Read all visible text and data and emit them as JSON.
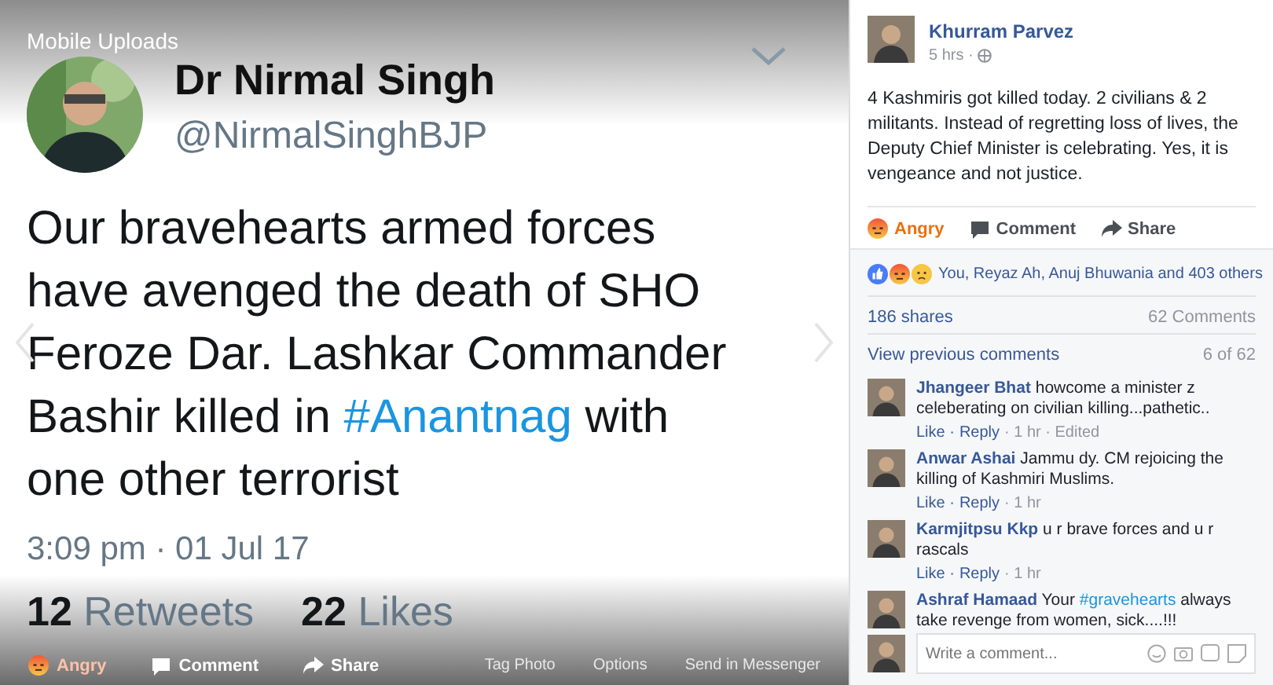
{
  "viewer": {
    "album": "Mobile Uploads",
    "tweet": {
      "name": "Dr Nirmal Singh",
      "handle": "@NirmalSinghBJP",
      "body": [
        {
          "kind": "plain",
          "text": "Our bravehearts armed forces have avenged the death of SHO Feroze Dar. Lashkar Commander Bashir killed in "
        },
        {
          "kind": "hashtag",
          "text": "#Anantnag"
        },
        {
          "kind": "plain",
          "text": " with one other terrorist"
        }
      ],
      "time": "3:09 pm · 01 Jul 17",
      "retweets_count": "12",
      "retweets_label": "Retweets",
      "likes_count": "22",
      "likes_label": "Likes"
    },
    "actions": [
      {
        "kind": "angry",
        "label": "Angry"
      },
      {
        "kind": "comment",
        "label": "Comment"
      },
      {
        "kind": "share",
        "label": "Share"
      }
    ],
    "links": [
      "Tag Photo",
      "Options",
      "Send in Messenger"
    ]
  },
  "post": {
    "author": "Khurram Parvez",
    "time": "5 hrs ·",
    "text": "4 Kashmiris got killed today. 2 civilians & 2 militants. Instead of regretting loss of lives, the Deputy Chief Minister is celebrating. Yes, it is vengeance and not justice.",
    "actions": [
      {
        "kind": "angry",
        "label": "Angry"
      },
      {
        "kind": "comment",
        "label": "Comment"
      },
      {
        "kind": "share",
        "label": "Share"
      }
    ],
    "reactions": "You, Reyaz Ah, Anuj Bhuwania and 403 others",
    "shares": "186 shares",
    "comments_count": "62 Comments",
    "view_previous": "View previous comments",
    "page": "6 of 62"
  },
  "comments": [
    {
      "author": "Jhangeer Bhat",
      "text": [
        {
          "kind": "plain",
          "text": "howcome a minister z celeberating on civilian killing...pathetic.."
        }
      ],
      "meta": [
        {
          "kind": "link",
          "text": "Like ·"
        },
        {
          "kind": "link",
          "text": "Reply"
        },
        {
          "kind": "plain",
          "text": "· 1 hr · Edited"
        }
      ]
    },
    {
      "author": "Anwar Ashai",
      "text": [
        {
          "kind": "plain",
          "text": "Jammu dy. CM rejoicing the killing of Kashmiri Muslims."
        }
      ],
      "meta": [
        {
          "kind": "link",
          "text": "Like ·"
        },
        {
          "kind": "link",
          "text": "Reply"
        },
        {
          "kind": "plain",
          "text": "· 1 hr"
        }
      ]
    },
    {
      "author": "Karmjitpsu Kkp",
      "text": [
        {
          "kind": "plain",
          "text": "u r brave forces and u r rascals"
        }
      ],
      "meta": [
        {
          "kind": "link",
          "text": "Like ·"
        },
        {
          "kind": "link",
          "text": "Reply"
        },
        {
          "kind": "plain",
          "text": "· 1 hr"
        }
      ]
    },
    {
      "author": "Ashraf Hamaad",
      "text": [
        {
          "kind": "plain",
          "text": "Your "
        },
        {
          "kind": "hashtag",
          "text": "#gravehearts"
        },
        {
          "kind": "plain",
          "text": " always take revenge from women, sick....!!!"
        }
      ]
    }
  ],
  "composer": {
    "placeholder": "Write a comment..."
  }
}
